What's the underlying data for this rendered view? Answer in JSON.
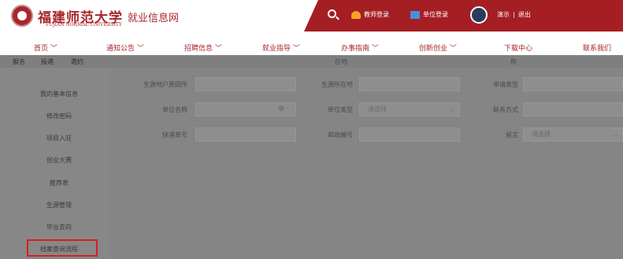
{
  "header": {
    "university_name": "福建师范大学",
    "university_en": "FUJIAN NORMAL UNIVERSITY",
    "site_title": "就业信息网",
    "teacher_login": "教师登录",
    "unit_login": "单位登录",
    "user_name": "演示",
    "separator": "|",
    "logout": "退出"
  },
  "nav": {
    "items": [
      {
        "label": "首页 ﹀"
      },
      {
        "label": "通知公告 ﹀"
      },
      {
        "label": "招聘信息 ﹀"
      },
      {
        "label": "就业指导 ﹀"
      },
      {
        "label": "办事指南 ﹀"
      },
      {
        "label": "创新创业 ﹀"
      },
      {
        "label": "下载中心"
      },
      {
        "label": "联系我们"
      }
    ]
  },
  "tabs": [
    "报名",
    "投递",
    "邀约"
  ],
  "top_labels": [
    "在地",
    "称"
  ],
  "sidebar": {
    "items": [
      {
        "label": "我的基本信息"
      },
      {
        "label": "修改密码"
      },
      {
        "label": "项目入驻"
      },
      {
        "label": "创业大赛"
      },
      {
        "label": "推荐表"
      },
      {
        "label": "生源管理"
      },
      {
        "label": "毕业去向"
      },
      {
        "label": "档案查询流程"
      }
    ]
  },
  "form": {
    "row1": {
      "label1": "生源地户原田所",
      "label2": "生源所在地",
      "label3": "申请类型"
    },
    "row2": {
      "label1": "单位名称",
      "input1_suffix": "中",
      "label2": "单位类型",
      "select2": "请选择",
      "label3": "联系方式"
    },
    "row3": {
      "label1": "快递单号",
      "label2": "邮政编号",
      "label3": "留言",
      "select3": "请选择"
    }
  },
  "colors": {
    "brand_red": "#a41e24",
    "highlight_border": "#d31f26",
    "overlay": "#7f7f7f"
  }
}
